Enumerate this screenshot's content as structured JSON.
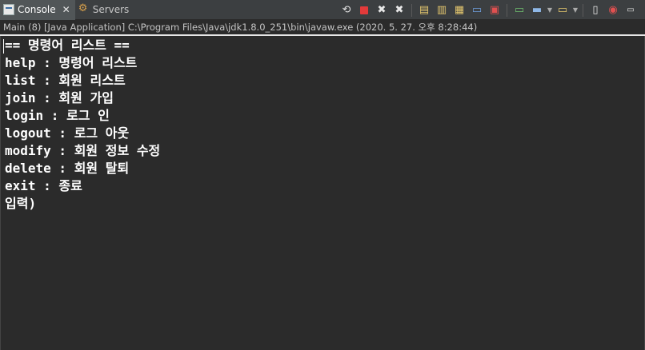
{
  "tabs": [
    {
      "label": "Console",
      "icon": "console-icon",
      "active": true
    },
    {
      "label": "Servers",
      "icon": "servers-icon",
      "active": false
    }
  ],
  "toolbar": {
    "icons": [
      "remove-launch-icon",
      "terminate-icon",
      "remove-icon",
      "remove-all-icon",
      "scroll-lock-icon",
      "word-wrap-icon",
      "show-stdout-icon",
      "show-stderr-icon",
      "pin-console-icon",
      "display-console-icon",
      "open-console-icon",
      "copy-icon",
      "new-window-icon"
    ]
  },
  "info": {
    "text": "Main (8) [Java Application] C:\\Program Files\\Java\\jdk1.8.0_251\\bin\\javaw.exe  (2020. 5. 27. 오후 8:28:44)"
  },
  "console": {
    "lines": [
      "== 명령어 리스트 ==",
      "help : 명령어 리스트",
      "list : 회원 리스트",
      "join : 회원 가입",
      "login : 로그 인",
      "logout : 로그 아웃",
      "modify : 회원 정보 수정",
      "delete : 회원 탈퇴",
      "exit : 종료",
      "입력)"
    ]
  }
}
